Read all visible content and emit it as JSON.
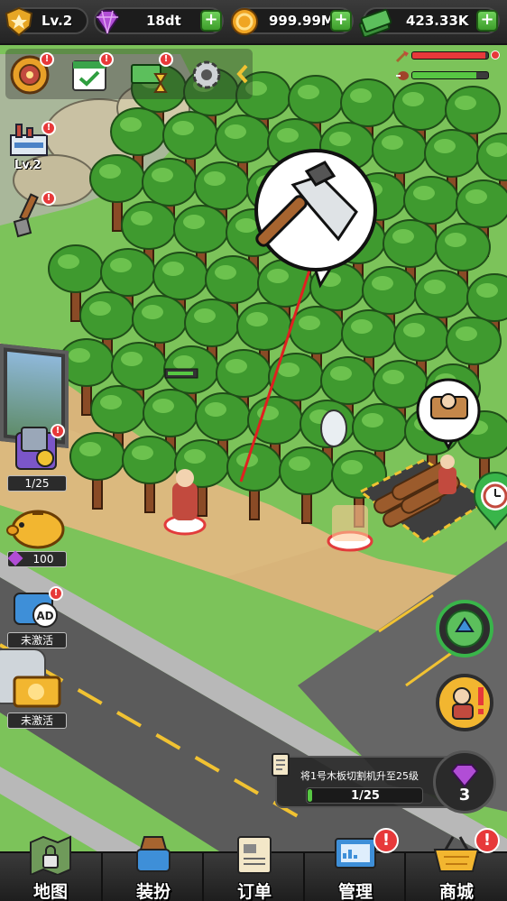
{
  "top_bar": {
    "level": "Lv.2",
    "gems": "18dt",
    "coins": "999.99M",
    "cash": "423.33K"
  },
  "factory": {
    "level": "Lv.2"
  },
  "side_panel": {
    "pack_progress": "1/25",
    "piggy_bank_gems": "100",
    "ad_card_status": "未激活",
    "ticket_status": "未激活"
  },
  "status_bars": {
    "wood_health_fraction": 0.96,
    "meat_health_fraction": 0.85
  },
  "task": {
    "text": "将1号木板切割机升至25级",
    "progress": "1/25",
    "progress_fraction": 0.04,
    "gem_reward": "3"
  },
  "bottom_nav": {
    "map": "地图",
    "dressup": "装扮",
    "orders": "订单",
    "manage": "管理",
    "shop": "商城"
  },
  "alerts": {
    "mark": "!"
  },
  "colors": {
    "grass": "#7cc35a",
    "tree": "#3f9a2f",
    "dirt": "#d8b47a",
    "road": "#5b5b5b",
    "alert": "#e7393a",
    "progress_green": "#57c743"
  },
  "icons": {
    "level": "shield-icon",
    "gems": "gem-icon",
    "coins": "coin-icon",
    "cash": "cash-stack-icon",
    "bank": "vault-icon",
    "tasks": "checklist-icon",
    "offline_income": "money-hourglass-icon",
    "settings": "gear-icon",
    "collapse": "chevron-left-icon",
    "factory": "factory-icon",
    "shovel": "shovel-icon",
    "axe": "axe-icon",
    "map": "map-lock-icon",
    "dressup": "outfit-icon",
    "orders": "newspaper-icon",
    "manage": "monitor-chart-icon",
    "shop": "basket-icon"
  }
}
